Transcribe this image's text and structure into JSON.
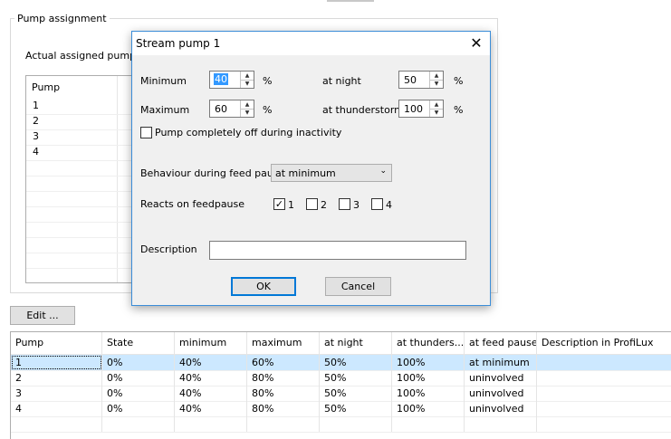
{
  "group": {
    "title": "Pump assignment",
    "assigned_label": "Actual assigned pumps:",
    "list_header": "Pump",
    "list_items": [
      "1",
      "2",
      "3",
      "4"
    ]
  },
  "edit_button": "Edit ...",
  "table": {
    "columns": [
      "Pump",
      "State",
      "minimum",
      "maximum",
      "at night",
      "at thunders...",
      "at feed pause",
      "Description in ProfiLux"
    ],
    "rows": [
      [
        "1",
        "0%",
        "40%",
        "60%",
        "50%",
        "100%",
        "at minimum",
        ""
      ],
      [
        "2",
        "0%",
        "40%",
        "80%",
        "50%",
        "100%",
        "uninvolved",
        ""
      ],
      [
        "3",
        "0%",
        "40%",
        "80%",
        "50%",
        "100%",
        "uninvolved",
        ""
      ],
      [
        "4",
        "0%",
        "40%",
        "80%",
        "50%",
        "100%",
        "uninvolved",
        ""
      ]
    ]
  },
  "dialog": {
    "title": "Stream pump 1",
    "close_glyph": "✕",
    "minimum": {
      "label": "Minimum",
      "value": "40",
      "unit": "%"
    },
    "maximum": {
      "label": "Maximum",
      "value": "60",
      "unit": "%"
    },
    "night": {
      "label": "at night",
      "value": "50",
      "unit": "%"
    },
    "thunderstorm": {
      "label": "at thunderstorm",
      "value": "100",
      "unit": "%"
    },
    "off_checkbox": "Pump completely off during inactivity",
    "behaviour_label": "Behaviour during feed pause",
    "behaviour_value": "at minimum",
    "reacts_label": "Reacts on feedpause",
    "reacts": [
      {
        "label": "1",
        "checked": true
      },
      {
        "label": "2",
        "checked": false
      },
      {
        "label": "3",
        "checked": false
      },
      {
        "label": "4",
        "checked": false
      }
    ],
    "description_label": "Description",
    "description_value": "",
    "ok": "OK",
    "cancel": "Cancel"
  },
  "colors": {
    "accent": "#0078d7",
    "selection": "#cce8ff",
    "text_highlight": "#3399ff"
  }
}
